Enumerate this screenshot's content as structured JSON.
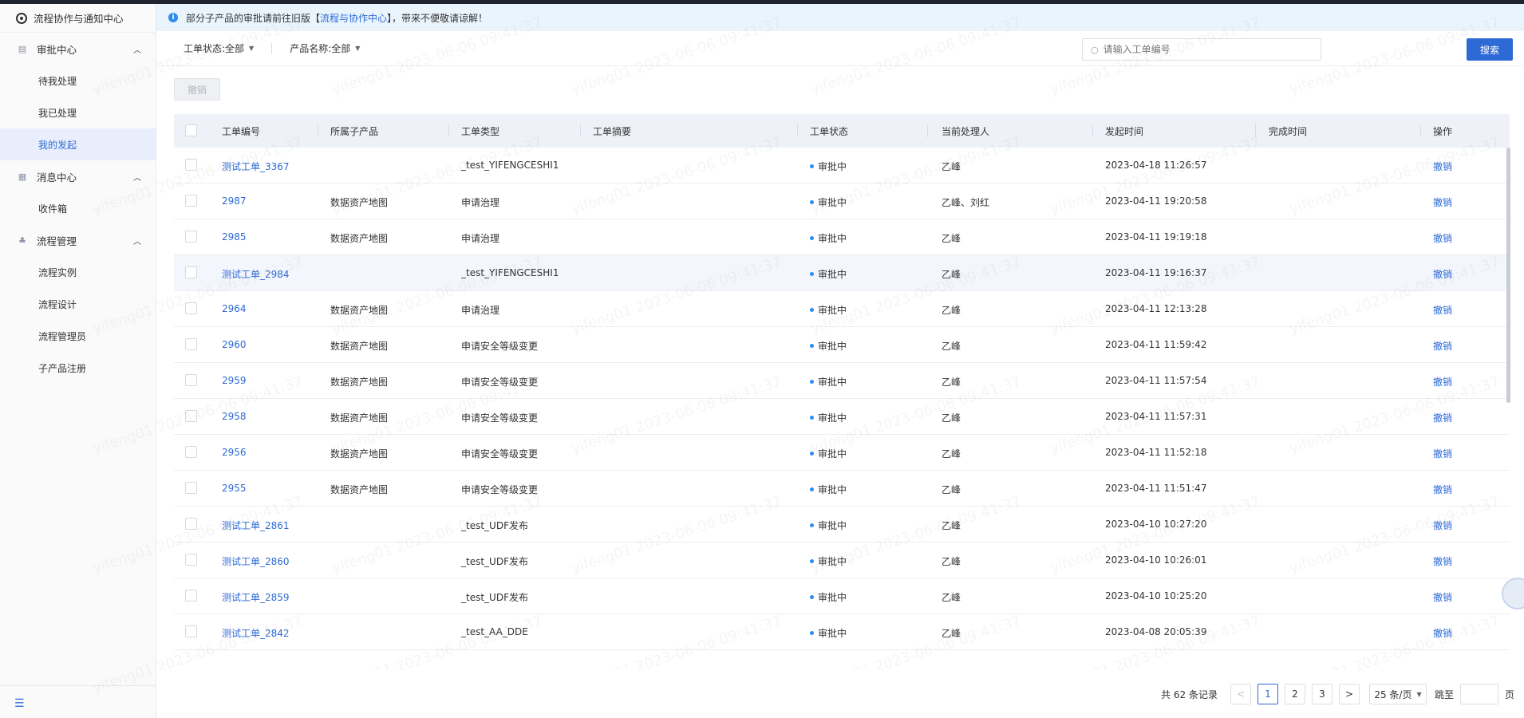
{
  "app": {
    "title": "流程协作与通知中心"
  },
  "sidebar": {
    "groups": [
      {
        "label": "审批中心",
        "icon": "approval-icon",
        "items": [
          "待我处理",
          "我已处理",
          "我的发起"
        ]
      },
      {
        "label": "消息中心",
        "icon": "message-icon",
        "items": [
          "收件箱"
        ]
      },
      {
        "label": "流程管理",
        "icon": "flow-icon",
        "items": [
          "流程实例",
          "流程设计",
          "流程管理员",
          "子产品注册"
        ]
      }
    ],
    "active_item": "我的发起"
  },
  "notice": {
    "prefix": "部分子产品的审批请前往旧版【",
    "link": "流程与协作中心",
    "suffix": "】，带来不便敬请谅解！"
  },
  "filters": {
    "status": "工单状态:全部",
    "product": "产品名称:全部"
  },
  "search": {
    "placeholder": "请输入工单编号",
    "button": "搜索"
  },
  "toolbar": {
    "revoke": "撤销"
  },
  "table": {
    "headers": [
      "工单编号",
      "所属子产品",
      "工单类型",
      "工单摘要",
      "工单状态",
      "当前处理人",
      "发起时间",
      "完成时间",
      "操作"
    ],
    "rows": [
      {
        "id": "测试工单_3367",
        "product": "",
        "type": "_test_YIFENGCESHI1",
        "summary": "",
        "status": "审批中",
        "handler": "乙峰",
        "start": "2023-04-18 11:26:57",
        "end": "",
        "action": "撤销"
      },
      {
        "id": "2987",
        "product": "数据资产地图",
        "type": "申请治理",
        "summary": "",
        "status": "审批中",
        "handler": "乙峰、刘红",
        "start": "2023-04-11 19:20:58",
        "end": "",
        "action": "撤销"
      },
      {
        "id": "2985",
        "product": "数据资产地图",
        "type": "申请治理",
        "summary": "",
        "status": "审批中",
        "handler": "乙峰",
        "start": "2023-04-11 19:19:18",
        "end": "",
        "action": "撤销"
      },
      {
        "id": "测试工单_2984",
        "product": "",
        "type": "_test_YIFENGCESHI1",
        "summary": "",
        "status": "审批中",
        "handler": "乙峰",
        "start": "2023-04-11 19:16:37",
        "end": "",
        "action": "撤销"
      },
      {
        "id": "2964",
        "product": "数据资产地图",
        "type": "申请治理",
        "summary": "",
        "status": "审批中",
        "handler": "乙峰",
        "start": "2023-04-11 12:13:28",
        "end": "",
        "action": "撤销"
      },
      {
        "id": "2960",
        "product": "数据资产地图",
        "type": "申请安全等级变更",
        "summary": "",
        "status": "审批中",
        "handler": "乙峰",
        "start": "2023-04-11 11:59:42",
        "end": "",
        "action": "撤销"
      },
      {
        "id": "2959",
        "product": "数据资产地图",
        "type": "申请安全等级变更",
        "summary": "",
        "status": "审批中",
        "handler": "乙峰",
        "start": "2023-04-11 11:57:54",
        "end": "",
        "action": "撤销"
      },
      {
        "id": "2958",
        "product": "数据资产地图",
        "type": "申请安全等级变更",
        "summary": "",
        "status": "审批中",
        "handler": "乙峰",
        "start": "2023-04-11 11:57:31",
        "end": "",
        "action": "撤销"
      },
      {
        "id": "2956",
        "product": "数据资产地图",
        "type": "申请安全等级变更",
        "summary": "",
        "status": "审批中",
        "handler": "乙峰",
        "start": "2023-04-11 11:52:18",
        "end": "",
        "action": "撤销"
      },
      {
        "id": "2955",
        "product": "数据资产地图",
        "type": "申请安全等级变更",
        "summary": "",
        "status": "审批中",
        "handler": "乙峰",
        "start": "2023-04-11 11:51:47",
        "end": "",
        "action": "撤销"
      },
      {
        "id": "测试工单_2861",
        "product": "",
        "type": "_test_UDF发布",
        "summary": "",
        "status": "审批中",
        "handler": "乙峰",
        "start": "2023-04-10 10:27:20",
        "end": "",
        "action": "撤销"
      },
      {
        "id": "测试工单_2860",
        "product": "",
        "type": "_test_UDF发布",
        "summary": "",
        "status": "审批中",
        "handler": "乙峰",
        "start": "2023-04-10 10:26:01",
        "end": "",
        "action": "撤销"
      },
      {
        "id": "测试工单_2859",
        "product": "",
        "type": "_test_UDF发布",
        "summary": "",
        "status": "审批中",
        "handler": "乙峰",
        "start": "2023-04-10 10:25:20",
        "end": "",
        "action": "撤销"
      },
      {
        "id": "测试工单_2842",
        "product": "",
        "type": "_test_AA_DDE",
        "summary": "",
        "status": "审批中",
        "handler": "乙峰",
        "start": "2023-04-08 20:05:39",
        "end": "",
        "action": "撤销"
      }
    ]
  },
  "pagination": {
    "total": "共 62 条记录",
    "pages": [
      "1",
      "2",
      "3"
    ],
    "current": "1",
    "page_size": "25 条/页",
    "jump_label": "跳至",
    "page_suffix": "页"
  },
  "watermark": "yifeng01 2023-06-06 09:41:37",
  "colors": {
    "accent": "#2d6ad6",
    "status_dot": "#2d8cf0",
    "notice_bg": "#e9f4fd",
    "header_bg": "#eef1f7"
  }
}
